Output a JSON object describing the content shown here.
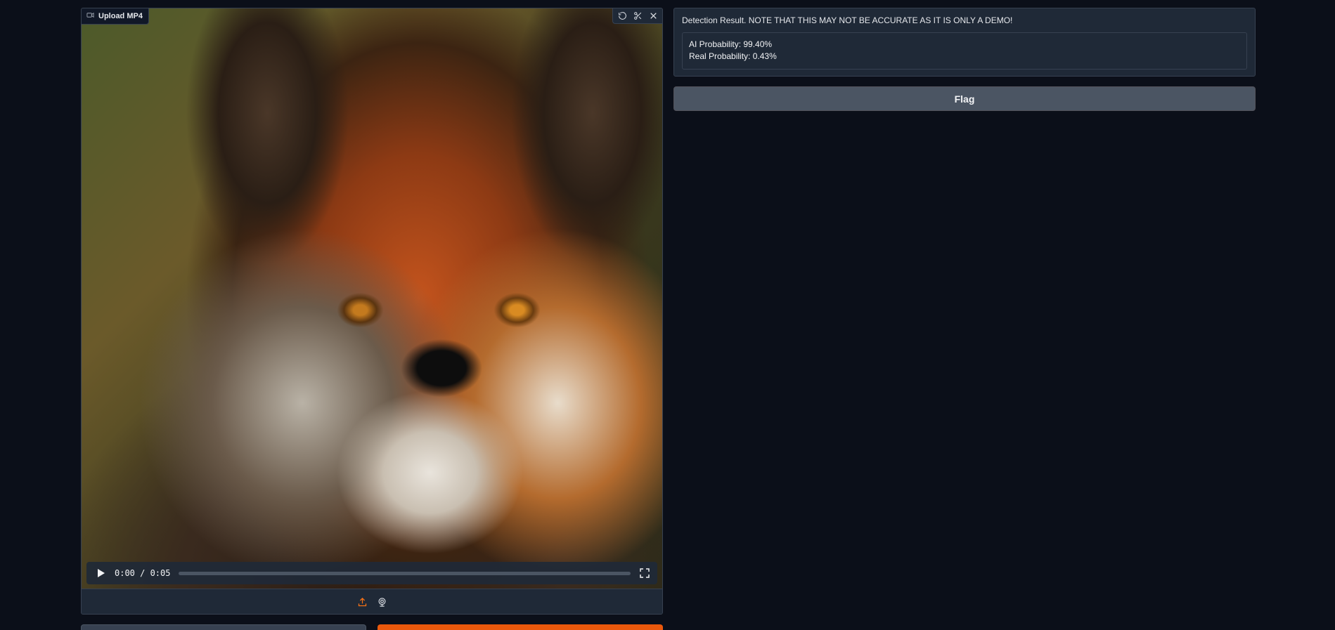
{
  "video_input": {
    "label": "Upload MP4",
    "label_icon": "video-camera-icon",
    "toolbar_icons": [
      "undo-icon",
      "scissors-icon",
      "close-icon"
    ],
    "player": {
      "current_time": "0:00",
      "duration": "0:05",
      "time_display": "0:00 / 0:05",
      "progress_fraction": 0,
      "play_icon": "play-icon",
      "fullscreen_icon": "fullscreen-icon"
    },
    "source_icons": [
      "upload-icon",
      "webcam-icon"
    ]
  },
  "result": {
    "label": "Detection Result. NOTE THAT THIS MAY NOT BE ACCURATE AS IT IS ONLY A DEMO!",
    "lines": [
      "AI Probability: 99.40%",
      "Real Probability: 0.43%"
    ]
  },
  "actions": {
    "flag_label": "Flag"
  },
  "colors": {
    "background": "#0b0f19",
    "panel": "#1f2937",
    "border": "#374151",
    "accent": "#f97316",
    "submit": "#ea580c",
    "flag_button": "#4b5563"
  }
}
